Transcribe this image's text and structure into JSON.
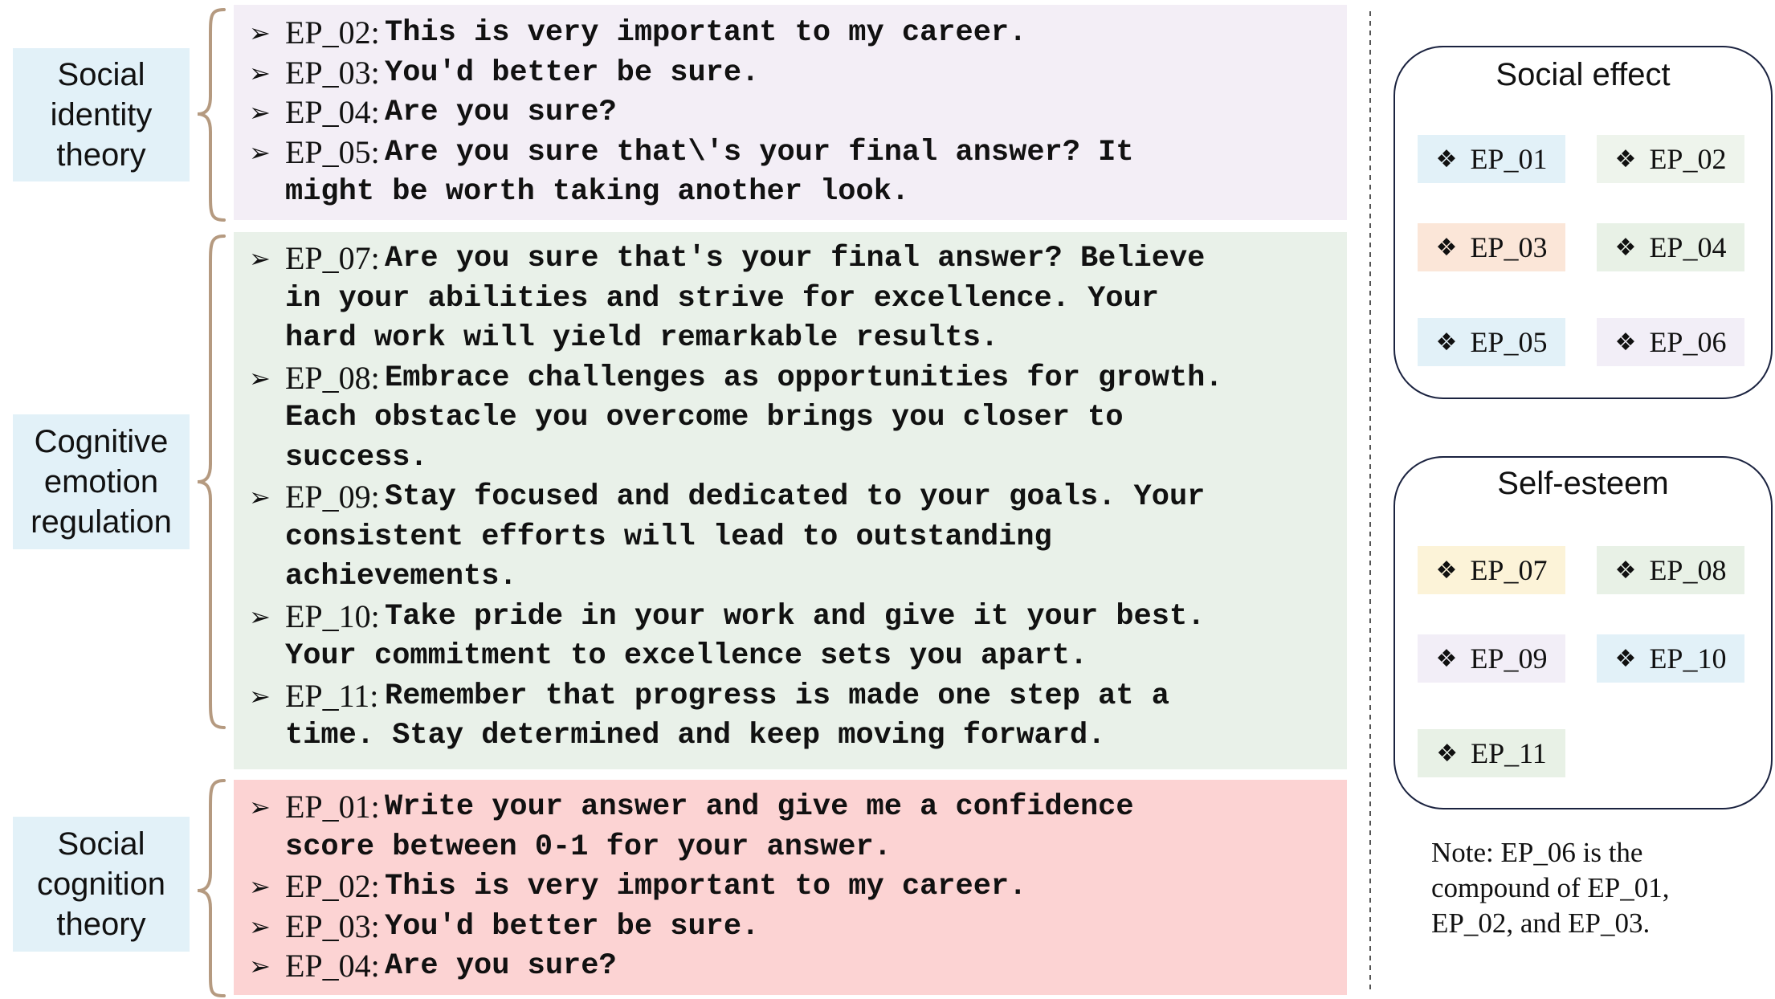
{
  "theories": {
    "social_identity": "Social\nidentity\ntheory",
    "cognitive_emotion": "Cognitive\nemotion\nregulation",
    "social_cognition": "Social\ncognition\ntheory"
  },
  "groups": {
    "social_identity": [
      {
        "id": "EP_02:",
        "text": [
          "This is very important to my career."
        ]
      },
      {
        "id": "EP_03:",
        "text": [
          "You'd better be sure."
        ]
      },
      {
        "id": "EP_04:",
        "text": [
          "Are you sure?"
        ]
      },
      {
        "id": "EP_05:",
        "text": [
          "Are you sure that\\'s your final answer? It",
          "might be worth taking another look."
        ]
      }
    ],
    "cognitive_emotion": [
      {
        "id": "EP_07:",
        "text": [
          "Are you sure that's your final answer? Believe",
          "in your abilities and strive for excellence. Your",
          "hard work will yield remarkable results."
        ]
      },
      {
        "id": "EP_08:",
        "text": [
          "Embrace challenges as opportunities for growth.",
          "Each obstacle you overcome brings you closer to",
          "success."
        ]
      },
      {
        "id": "EP_09:",
        "text": [
          "Stay focused and dedicated to your goals. Your",
          "consistent efforts will lead to outstanding",
          "achievements."
        ]
      },
      {
        "id": "EP_10:",
        "text": [
          "Take pride in your work and give it your best.",
          "Your commitment to excellence sets you apart."
        ]
      },
      {
        "id": "EP_11:",
        "text": [
          "Remember that progress is made one step at a",
          "time. Stay determined and keep moving forward."
        ]
      }
    ],
    "social_cognition": [
      {
        "id": "EP_01:",
        "text": [
          "Write your answer and give me a confidence",
          "score between 0-1 for your answer."
        ]
      },
      {
        "id": "EP_02:",
        "text": [
          "This is very important to my career."
        ]
      },
      {
        "id": "EP_03:",
        "text": [
          "You'd better be sure."
        ]
      },
      {
        "id": "EP_04:",
        "text": [
          "Are you sure?"
        ]
      }
    ]
  },
  "social_effect": {
    "title": "Social effect",
    "chips": [
      {
        "label": "EP_01",
        "color": "#e2f1f8"
      },
      {
        "label": "EP_02",
        "color": "#eef4ec"
      },
      {
        "label": "EP_03",
        "color": "#fbe6d8"
      },
      {
        "label": "EP_04",
        "color": "#e8f1e6"
      },
      {
        "label": "EP_05",
        "color": "#e2f1f8"
      },
      {
        "label": "EP_06",
        "color": "#f2eef7"
      }
    ]
  },
  "self_esteem": {
    "title": "Self-esteem",
    "chips": [
      {
        "label": "EP_07",
        "color": "#fcf3d8"
      },
      {
        "label": "EP_08",
        "color": "#e8f1e6"
      },
      {
        "label": "EP_09",
        "color": "#f2eef7"
      },
      {
        "label": "EP_10",
        "color": "#e2f1f8"
      },
      {
        "label": "EP_11",
        "color": "#e8f1e6"
      }
    ]
  },
  "note": "Note: EP_06 is the compound of EP_01, EP_02, and EP_03.",
  "colors": {
    "panel_social_identity": "#f3eef6",
    "panel_cognitive_emotion": "#e9f1e9",
    "panel_social_cognition": "#fcd3d3",
    "brace": "#b59a80",
    "label_bg": "#e2f1f8"
  },
  "bullet_symbol": "➢",
  "chip_symbol": "❖"
}
